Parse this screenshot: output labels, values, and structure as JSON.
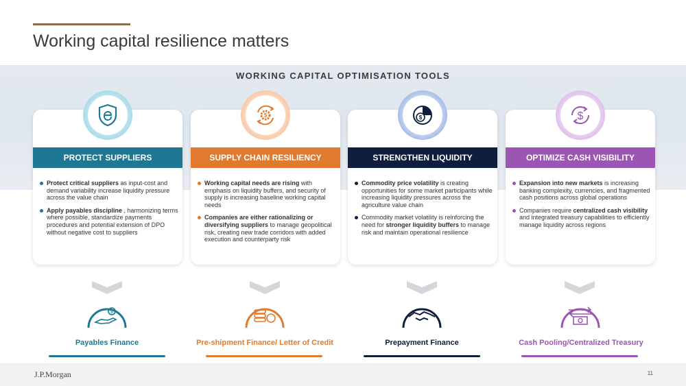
{
  "slide": {
    "title": "Working capital resilience matters",
    "section_title": "WORKING CAPITAL OPTIMISATION TOOLS"
  },
  "colors": {
    "teal": "#1f7893",
    "orange": "#e07a2f",
    "navy": "#0f1e3d",
    "purple": "#9b55b2",
    "accent_rule": "#8c6d4f"
  },
  "cards": [
    {
      "heading": "PROTECT SUPPLIERS",
      "icon": "shield-icon",
      "bullets": [
        {
          "bold": "Protect critical suppliers",
          "text": " as input-cost and demand variability increase liquidity pressure across the value chain"
        },
        {
          "bold": "Apply payables discipline",
          "text": " , harmonizing terms where possible, standardize payments procedures and potential extension of DPO without negative cost to suppliers"
        }
      ]
    },
    {
      "heading": "SUPPLY CHAIN RESILIENCY",
      "icon": "gear-cycle-icon",
      "bullets": [
        {
          "bold": "Working capital needs are rising",
          "text": " with emphasis on liquidity buffers, and security of supply is increasing baseline working capital needs"
        },
        {
          "bold": "Companies are either rationalizing or diversifying suppliers",
          "text": " to manage geopolitical risk, creating new trade corridors with added execution and counterparty risk"
        }
      ]
    },
    {
      "heading": "STRENGTHEN LIQUIDITY",
      "icon": "pie-dollar-icon",
      "bullets": [
        {
          "bold": "Commodity price volatility",
          "text": " is creating opportunities for some market participants while increasing liquidity pressures across the agriculture value chain"
        },
        {
          "pre": "Commodity market volatility is reinforcing the need for ",
          "bold": "stronger liquidity buffers",
          "text": " to manage risk and maintain operational resilience"
        }
      ]
    },
    {
      "heading": "OPTIMIZE CASH VISIBILITY",
      "icon": "dollar-cycle-icon",
      "bullets": [
        {
          "bold": "Expansion into new markets",
          "text": "  is increasing banking complexity, currencies, and fragmented cash positions across global operations"
        },
        {
          "pre": "Companies require ",
          "bold": "centralized cash visibility",
          "text": " and integrated treasury capabilities to efficiently manage liquidity across regions"
        }
      ]
    }
  ],
  "solutions": [
    {
      "label": "Payables Finance",
      "icon": "hand-coin-icon"
    },
    {
      "label": "Pre-shipment Finance/ Letter of Credit",
      "icon": "coin-stack-icon"
    },
    {
      "label": "Prepayment Finance",
      "icon": "handshake-icon"
    },
    {
      "label": "Cash Pooling/Centralized Treasury",
      "icon": "cash-transfer-icon"
    }
  ],
  "footer": {
    "logo": "J.P.Morgan",
    "page_number": "11"
  }
}
